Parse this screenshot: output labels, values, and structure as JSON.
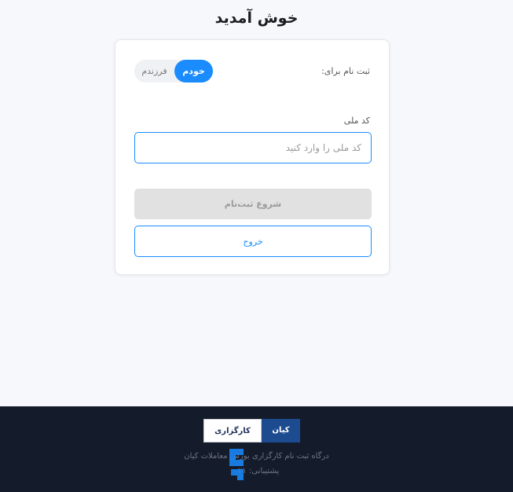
{
  "page": {
    "title": "خوش آمدید"
  },
  "register_for": {
    "label": "ثبت نام برای:",
    "options": [
      "خودم",
      "فرزندم"
    ],
    "selected": "خودم"
  },
  "national_id": {
    "label": "کد ملی",
    "value": "",
    "placeholder": "کد ملی را وارد کنید"
  },
  "actions": {
    "start_label": "شروع ثبت‌نام",
    "exit_label": "خروج"
  },
  "footer": {
    "logo_text": "کارگزاری",
    "logo_brand": "کیان",
    "line1": "درگاه ثبت نام کارگزاری بورس معاملات کیان",
    "line2": "پشتیبانی: ۰۲۱"
  },
  "colors": {
    "accent": "#1a8cff",
    "footer_bg": "#141b2a",
    "page_bg": "#f7f8fc"
  }
}
